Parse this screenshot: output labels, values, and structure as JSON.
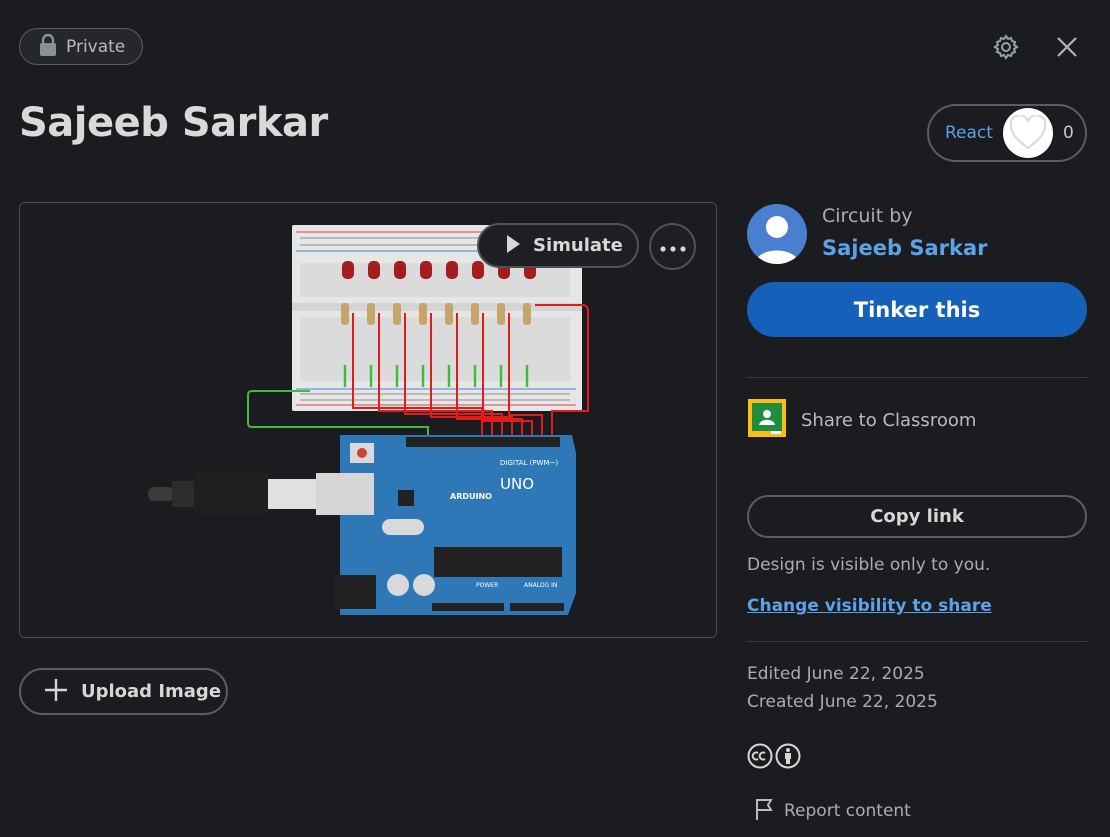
{
  "header": {
    "visibility_badge": "Private",
    "title": "Sajeeb Sarkar"
  },
  "react": {
    "label": "React",
    "count": "0"
  },
  "canvas": {
    "simulate_label": "Simulate",
    "board_brand": "ARDUINO",
    "board_model": "UNO",
    "digital_header": "DIGITAL (PWM~)",
    "power_header": "POWER",
    "analog_header": "ANALOG IN"
  },
  "upload": {
    "label": "Upload Image"
  },
  "sidebar": {
    "circuit_by": "Circuit by",
    "author": "Sajeeb Sarkar",
    "tinker_label": "Tinker this",
    "share_classroom": "Share to Classroom",
    "copy_link": "Copy link",
    "visibility_note": "Design is visible only to you.",
    "change_visibility": "Change visibility to share",
    "edited": "Edited June 22, 2025",
    "created": "Created June 22, 2025",
    "report": "Report content"
  },
  "colors": {
    "background": "#1b1c1f",
    "accent_blue": "#1560b8",
    "link_blue": "#5ba2e8",
    "arduino_teal": "#2f78b7"
  }
}
